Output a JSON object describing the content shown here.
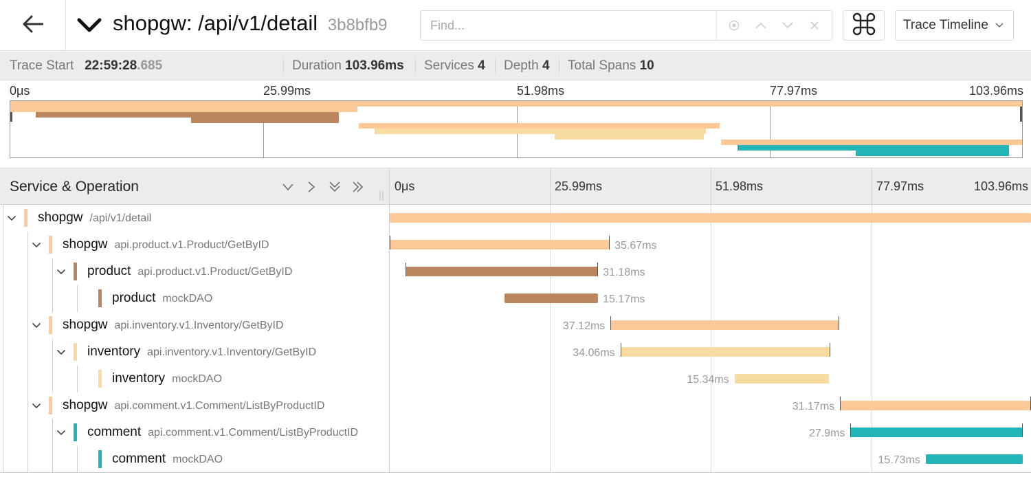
{
  "header": {
    "back_icon": "arrow-left-icon",
    "collapse_icon": "chevron-down-icon",
    "title": "shopgw: /api/v1/detail",
    "trace_id": "3b8bfb9",
    "find_placeholder": "Find...",
    "find_icons": [
      "locate-icon",
      "chevron-up-icon",
      "chevron-down-icon",
      "close-icon"
    ],
    "command_icon": "command-icon",
    "view_select": "Trace Timeline"
  },
  "summary": {
    "trace_start_label": "Trace Start",
    "trace_start_main": "22:59:28",
    "trace_start_ms": ".685",
    "duration_label": "Duration",
    "duration_value": "103.96ms",
    "services_label": "Services",
    "services_value": "4",
    "depth_label": "Depth",
    "depth_value": "4",
    "total_spans_label": "Total Spans",
    "total_spans_value": "10"
  },
  "timeline": {
    "total_ms": 103.96,
    "ticks": [
      "0μs",
      "25.99ms",
      "51.98ms",
      "77.97ms",
      "103.96ms"
    ]
  },
  "detail": {
    "title": "Service & Operation",
    "controls": [
      "collapse-one-icon",
      "expand-one-icon",
      "collapse-all-icon",
      "expand-all-icon"
    ]
  },
  "colors": {
    "shopgw": "#fdc998",
    "product": "#ba8660",
    "inventory": "#f7dba0",
    "comment": "#22b5b8"
  },
  "spans": [
    {
      "depth": 0,
      "service": "shopgw",
      "operation": "/api/v1/detail",
      "start_ms": 0.0,
      "duration_ms": 103.96,
      "label": "",
      "label_side": "none",
      "expanded": true,
      "has_children": true
    },
    {
      "depth": 1,
      "service": "shopgw",
      "operation": "api.product.v1.Product/GetByID",
      "start_ms": 0.0,
      "duration_ms": 35.67,
      "label": "35.67ms",
      "label_side": "right",
      "expanded": true,
      "has_children": true
    },
    {
      "depth": 2,
      "service": "product",
      "operation": "api.product.v1.Product/GetByID",
      "start_ms": 2.6,
      "duration_ms": 31.18,
      "label": "31.18ms",
      "label_side": "right",
      "expanded": true,
      "has_children": true
    },
    {
      "depth": 3,
      "service": "product",
      "operation": "mockDAO",
      "start_ms": 18.6,
      "duration_ms": 15.17,
      "label": "15.17ms",
      "label_side": "right",
      "expanded": false,
      "has_children": false
    },
    {
      "depth": 1,
      "service": "shopgw",
      "operation": "api.inventory.v1.Inventory/GetByID",
      "start_ms": 35.8,
      "duration_ms": 37.12,
      "label": "37.12ms",
      "label_side": "left",
      "expanded": true,
      "has_children": true
    },
    {
      "depth": 2,
      "service": "inventory",
      "operation": "api.inventory.v1.Inventory/GetByID",
      "start_ms": 37.4,
      "duration_ms": 34.06,
      "label": "34.06ms",
      "label_side": "left",
      "expanded": true,
      "has_children": true
    },
    {
      "depth": 3,
      "service": "inventory",
      "operation": "mockDAO",
      "start_ms": 55.9,
      "duration_ms": 15.34,
      "label": "15.34ms",
      "label_side": "left",
      "expanded": false,
      "has_children": false
    },
    {
      "depth": 1,
      "service": "shopgw",
      "operation": "api.comment.v1.Comment/ListByProductID",
      "start_ms": 73.0,
      "duration_ms": 31.17,
      "label": "31.17ms",
      "label_side": "left",
      "expanded": true,
      "has_children": true
    },
    {
      "depth": 2,
      "service": "comment",
      "operation": "api.comment.v1.Comment/ListByProductID",
      "start_ms": 74.7,
      "duration_ms": 27.9,
      "label": "27.9ms",
      "label_side": "left",
      "expanded": true,
      "has_children": true
    },
    {
      "depth": 3,
      "service": "comment",
      "operation": "mockDAO",
      "start_ms": 86.9,
      "duration_ms": 15.73,
      "label": "15.73ms",
      "label_side": "left",
      "expanded": false,
      "has_children": false
    }
  ]
}
